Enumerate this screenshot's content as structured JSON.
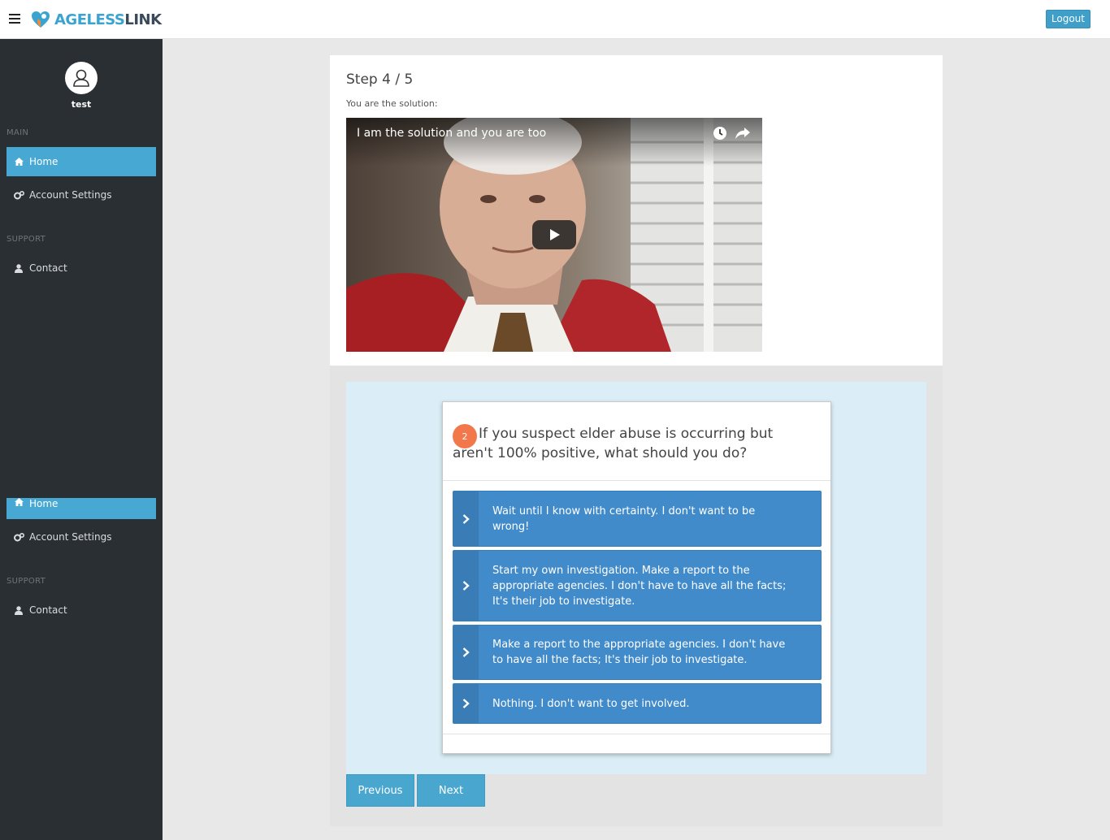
{
  "header": {
    "logo_part1": "AGELESS",
    "logo_part2": "LINK",
    "logout_label": "Logout"
  },
  "sidebar": {
    "username": "test",
    "sections": [
      {
        "title": "MAIN",
        "items": [
          {
            "label": "Home",
            "icon": "home-icon",
            "active": true
          },
          {
            "label": "Account Settings",
            "icon": "cogs-icon",
            "active": false
          }
        ]
      },
      {
        "title": "SUPPORT",
        "items": [
          {
            "label": "Contact",
            "icon": "user-icon",
            "active": false
          }
        ]
      }
    ],
    "duplicate": {
      "home_label": "Home",
      "account_label": "Account Settings",
      "support_title": "SUPPORT",
      "contact_label": "Contact"
    }
  },
  "main": {
    "step_title": "Step 4 / 5",
    "step_subtitle": "You are the solution:",
    "video": {
      "title": "I am the solution and you are too",
      "controls": [
        "watch-later-icon",
        "share-icon",
        "play-icon"
      ]
    },
    "question": {
      "number": "2",
      "text": "If you suspect elder abuse is occurring but aren't 100% positive, what should you do?",
      "answers": [
        "Wait until I know with certainty. I don't want to be wrong!",
        "Start my own investigation. Make a report to the appropriate agencies. I don't have to have all the facts; It's their job to investigate.",
        "Make a report to the appropriate agencies. I don't have to have all the facts; It's their job to investigate.",
        "Nothing. I don't want to get involved."
      ]
    },
    "previous_label": "Previous",
    "next_label": "Next"
  },
  "colors": {
    "sidebar_bg": "#2a2f33",
    "accent": "#46a8d3",
    "answer_bg": "#428bca",
    "badge": "#f2784b"
  }
}
